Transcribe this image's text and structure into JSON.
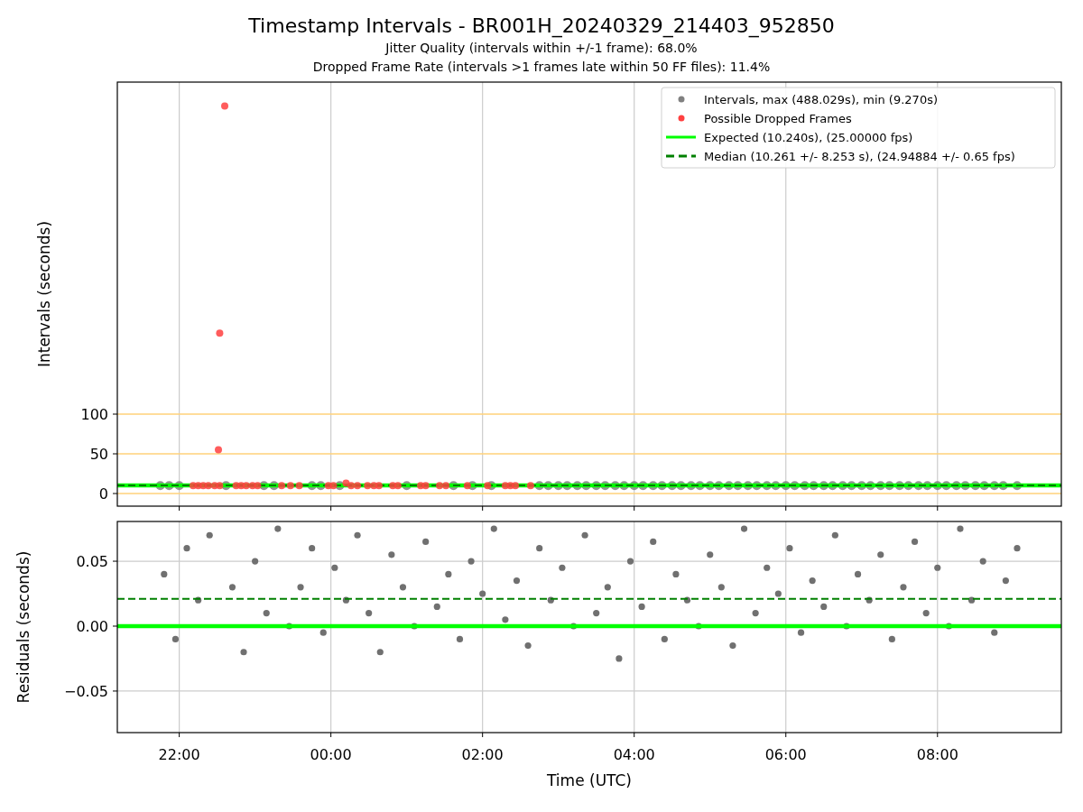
{
  "figure": {
    "title": "Timestamp Intervals - BR001H_20240329_214403_952850",
    "subtitles": [
      "Jitter Quality (intervals within +/-1 frame): 68.0%",
      "Dropped Frame Rate (intervals >1 frames late within 50 FF files): 11.4%"
    ]
  },
  "panels": [
    {
      "chart_data": {
        "type": "scatter",
        "ylabel": "Intervals (seconds)",
        "xlim": [
          "2024-03-29T21:11",
          "2024-03-30T09:38"
        ],
        "ylim": [
          -15.9,
          518.2
        ],
        "yticks": [
          0,
          50,
          100
        ],
        "grid": "x",
        "legend": true,
        "series": [
          {
            "name": "Intervals, max (488.029s), min (9.270s)",
            "color": "#808080",
            "x": [
              "2024-03-29T21:45",
              "2024-03-29T21:52",
              "2024-03-29T22:00",
              "2024-03-29T22:37",
              "2024-03-29T23:07",
              "2024-03-29T23:15",
              "2024-03-29T23:45",
              "2024-03-29T23:52",
              "2024-03-30T00:07",
              "2024-03-30T01:00",
              "2024-03-30T01:37",
              "2024-03-30T01:52",
              "2024-03-30T02:07",
              "2024-03-30T02:45",
              "2024-03-30T02:52",
              "2024-03-30T03:00",
              "2024-03-30T03:07",
              "2024-03-30T03:15",
              "2024-03-30T03:22",
              "2024-03-30T03:30",
              "2024-03-30T03:37",
              "2024-03-30T03:45",
              "2024-03-30T03:52",
              "2024-03-30T04:00",
              "2024-03-30T04:07",
              "2024-03-30T04:15",
              "2024-03-30T04:22",
              "2024-03-30T04:30",
              "2024-03-30T04:37",
              "2024-03-30T04:45",
              "2024-03-30T04:52",
              "2024-03-30T05:00",
              "2024-03-30T05:07",
              "2024-03-30T05:15",
              "2024-03-30T05:22",
              "2024-03-30T05:30",
              "2024-03-30T05:37",
              "2024-03-30T05:45",
              "2024-03-30T05:52",
              "2024-03-30T06:00",
              "2024-03-30T06:07",
              "2024-03-30T06:15",
              "2024-03-30T06:22",
              "2024-03-30T06:30",
              "2024-03-30T06:37",
              "2024-03-30T06:45",
              "2024-03-30T06:52",
              "2024-03-30T07:00",
              "2024-03-30T07:07",
              "2024-03-30T07:15",
              "2024-03-30T07:22",
              "2024-03-30T07:30",
              "2024-03-30T07:37",
              "2024-03-30T07:45",
              "2024-03-30T07:52",
              "2024-03-30T08:00",
              "2024-03-30T08:07",
              "2024-03-30T08:15",
              "2024-03-30T08:22",
              "2024-03-30T08:30",
              "2024-03-30T08:37",
              "2024-03-30T08:45",
              "2024-03-30T08:52",
              "2024-03-30T09:03"
            ],
            "values": [
              10,
              10,
              10,
              10,
              10,
              10,
              10,
              10,
              10,
              10,
              10,
              10,
              10,
              10,
              10,
              10,
              10,
              10,
              10,
              10,
              10,
              10,
              10,
              10,
              10,
              10,
              10,
              10,
              10,
              10,
              10,
              10,
              10,
              10,
              10,
              10,
              10,
              10,
              10,
              10,
              10,
              10,
              10,
              10,
              10,
              10,
              10,
              10,
              10,
              10,
              10,
              10,
              10,
              10,
              10,
              10,
              10,
              10,
              10,
              10,
              10,
              10,
              10,
              10
            ]
          },
          {
            "name": "Possible Dropped Frames",
            "color": "#ff4040",
            "x": [
              "2024-03-29T22:11",
              "2024-03-29T22:15",
              "2024-03-29T22:19",
              "2024-03-29T22:23",
              "2024-03-29T22:28",
              "2024-03-29T22:32",
              "2024-03-29T22:36",
              "2024-03-29T22:32",
              "2024-03-29T22:31",
              "2024-03-29T22:45",
              "2024-03-29T22:49",
              "2024-03-29T22:53",
              "2024-03-29T22:58",
              "2024-03-29T23:02",
              "2024-03-29T23:21",
              "2024-03-29T23:28",
              "2024-03-29T23:35",
              "2024-03-29T23:58",
              "2024-03-30T00:02",
              "2024-03-30T00:12",
              "2024-03-30T00:16",
              "2024-03-30T00:21",
              "2024-03-30T00:29",
              "2024-03-30T00:34",
              "2024-03-30T00:38",
              "2024-03-30T00:49",
              "2024-03-30T00:53",
              "2024-03-30T01:11",
              "2024-03-30T01:15",
              "2024-03-30T01:26",
              "2024-03-30T01:31",
              "2024-03-30T01:48",
              "2024-03-30T02:04",
              "2024-03-30T02:18",
              "2024-03-30T02:22",
              "2024-03-30T02:26",
              "2024-03-30T02:38"
            ],
            "values": [
              10,
              10,
              10,
              10,
              10,
              10,
              488,
              202,
              55,
              10,
              10,
              10,
              10,
              10,
              10,
              10,
              10,
              10,
              10,
              13,
              10,
              10,
              10,
              10,
              10,
              10,
              10,
              10,
              10,
              10,
              10,
              10,
              10,
              10,
              10,
              10,
              10
            ]
          }
        ],
        "ref_lines": [
          {
            "axis": "y",
            "value": 0,
            "color": "#ffd27a"
          },
          {
            "axis": "y",
            "value": 50,
            "color": "#ffd27a"
          },
          {
            "axis": "y",
            "value": 100,
            "color": "#ffd27a"
          },
          {
            "axis": "y",
            "value": 10.24,
            "color": "#00ff00",
            "label": "Expected (10.240s), (25.00000 fps)"
          },
          {
            "axis": "y",
            "value": 10.261,
            "color": "#008000",
            "label": "Median (10.261 +/- 8.253 s), (24.94884 +/- 0.65 fps)"
          }
        ]
      }
    },
    {
      "chart_data": {
        "type": "scatter",
        "xlabel": "Time (UTC)",
        "ylabel": "Residuals (seconds)",
        "xlim": [
          "2024-03-29T21:11",
          "2024-03-30T09:38"
        ],
        "ylim": [
          -0.082,
          0.0806
        ],
        "grid": "both",
        "xticks": [
          {
            "value": "2024-03-29T22:00",
            "label": "22:00"
          },
          {
            "value": "2024-03-30T00:00",
            "label": "00:00"
          },
          {
            "value": "2024-03-30T02:00",
            "label": "02:00"
          },
          {
            "value": "2024-03-30T04:00",
            "label": "04:00"
          },
          {
            "value": "2024-03-30T06:00",
            "label": "06:00"
          },
          {
            "value": "2024-03-30T08:00",
            "label": "08:00"
          }
        ],
        "yticks": [
          {
            "value": -0.05,
            "label": "−0.05"
          },
          {
            "value": 0,
            "label": "0.00"
          },
          {
            "value": 0.05,
            "label": "0.05"
          }
        ],
        "series": [
          {
            "color": "#707070",
            "x": [
              "2024-03-29T21:48",
              "2024-03-29T21:57",
              "2024-03-29T22:06",
              "2024-03-29T22:15",
              "2024-03-29T22:24",
              "2024-03-29T22:42",
              "2024-03-29T22:51",
              "2024-03-29T23:00",
              "2024-03-29T23:09",
              "2024-03-29T23:18",
              "2024-03-29T23:27",
              "2024-03-29T23:36",
              "2024-03-29T23:45",
              "2024-03-29T23:54",
              "2024-03-30T00:03",
              "2024-03-30T00:12",
              "2024-03-30T00:21",
              "2024-03-30T00:30",
              "2024-03-30T00:39",
              "2024-03-30T00:48",
              "2024-03-30T00:57",
              "2024-03-30T01:06",
              "2024-03-30T01:15",
              "2024-03-30T01:24",
              "2024-03-30T01:33",
              "2024-03-30T01:42",
              "2024-03-30T01:51",
              "2024-03-30T02:00",
              "2024-03-30T02:09",
              "2024-03-30T02:18",
              "2024-03-30T02:27",
              "2024-03-30T02:36",
              "2024-03-30T02:45",
              "2024-03-30T02:54",
              "2024-03-30T03:03",
              "2024-03-30T03:12",
              "2024-03-30T03:21",
              "2024-03-30T03:30",
              "2024-03-30T03:39",
              "2024-03-30T03:48",
              "2024-03-30T03:57",
              "2024-03-30T04:06",
              "2024-03-30T04:15",
              "2024-03-30T04:24",
              "2024-03-30T04:33",
              "2024-03-30T04:42",
              "2024-03-30T04:51",
              "2024-03-30T05:00",
              "2024-03-30T05:09",
              "2024-03-30T05:18",
              "2024-03-30T05:27",
              "2024-03-30T05:36",
              "2024-03-30T05:45",
              "2024-03-30T05:54",
              "2024-03-30T06:03",
              "2024-03-30T06:12",
              "2024-03-30T06:21",
              "2024-03-30T06:30",
              "2024-03-30T06:39",
              "2024-03-30T06:48",
              "2024-03-30T06:57",
              "2024-03-30T07:06",
              "2024-03-30T07:15",
              "2024-03-30T07:24",
              "2024-03-30T07:33",
              "2024-03-30T07:42",
              "2024-03-30T07:51",
              "2024-03-30T08:00",
              "2024-03-30T08:09",
              "2024-03-30T08:18",
              "2024-03-30T08:27",
              "2024-03-30T08:36",
              "2024-03-30T08:45",
              "2024-03-30T08:54",
              "2024-03-30T09:03"
            ],
            "values": [
              0.04,
              -0.01,
              0.06,
              0.02,
              0.07,
              0.03,
              -0.02,
              0.05,
              0.01,
              0.075,
              0.0,
              0.03,
              0.06,
              -0.005,
              0.045,
              0.02,
              0.07,
              0.01,
              -0.02,
              0.055,
              0.03,
              0.0,
              0.065,
              0.015,
              0.04,
              -0.01,
              0.05,
              0.025,
              0.075,
              0.005,
              0.035,
              -0.015,
              0.06,
              0.02,
              0.045,
              0.0,
              0.07,
              0.01,
              0.03,
              -0.025,
              0.05,
              0.015,
              0.065,
              -0.01,
              0.04,
              0.02,
              0.0,
              0.055,
              0.03,
              -0.015,
              0.075,
              0.01,
              0.045,
              0.025,
              0.06,
              -0.005,
              0.035,
              0.015,
              0.07,
              0.0,
              0.04,
              0.02,
              0.055,
              -0.01,
              0.03,
              0.065,
              0.01,
              0.045,
              0.0,
              0.075,
              0.02,
              0.05,
              -0.005,
              0.035,
              0.06
            ]
          }
        ],
        "ref_lines": [
          {
            "axis": "y",
            "value": 0,
            "color": "#00ff00"
          },
          {
            "axis": "y",
            "value": 0.021,
            "color": "#008000"
          }
        ]
      }
    }
  ]
}
